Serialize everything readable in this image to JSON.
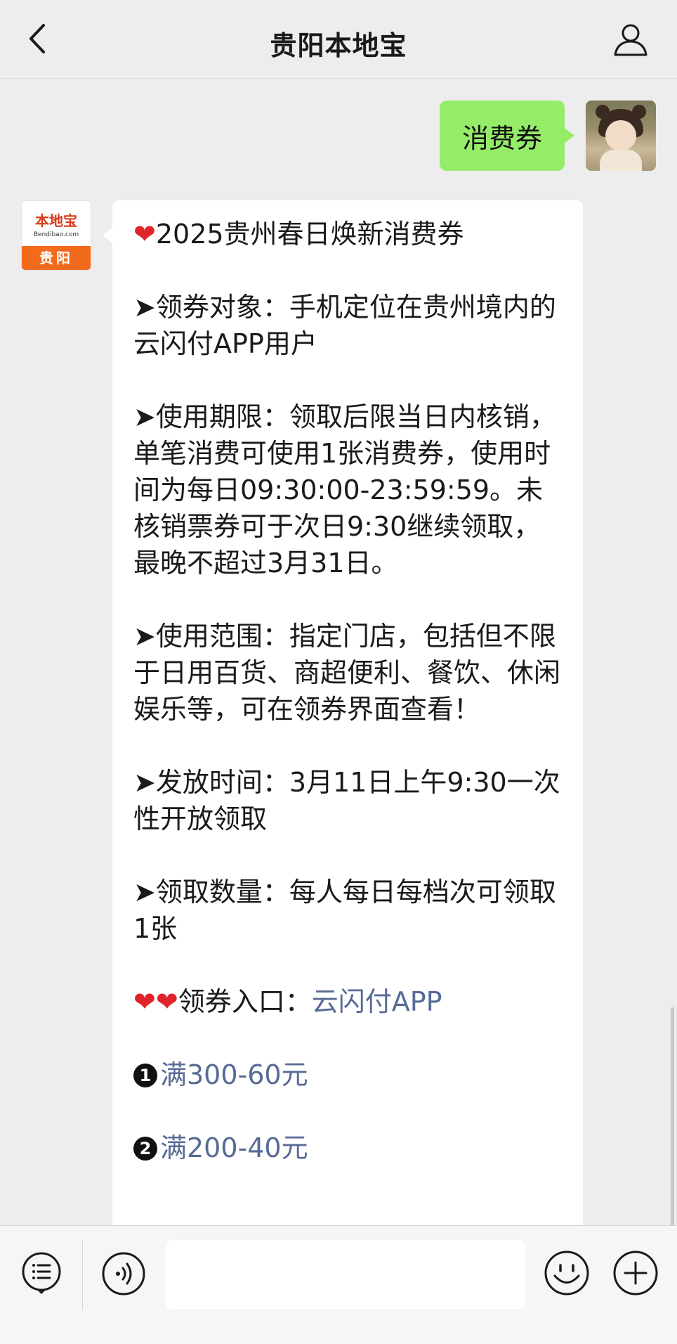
{
  "header": {
    "title": "贵阳本地宝"
  },
  "chat": {
    "my_message": "消费券",
    "bot_avatar": {
      "logo_text": "本地宝",
      "logo_url": "Bendibao.com",
      "city": "贵阳"
    },
    "bot_message": {
      "title": "2025贵州春日焕新消费券",
      "p1": "➤领券对象：手机定位在贵州境内的云闪付APP用户",
      "p2": "➤使用期限：领取后限当日内核销，单笔消费可使用1张消费券，使用时间为每日09:30:00-23:59:59。未核销票券可于次日9:30继续领取，最晚不超过3月31日。",
      "p3": "➤使用范围：指定门店，包括但不限于日用百货、商超便利、餐饮、休闲娱乐等，可在领券界面查看！",
      "p4": "➤发放时间：3月11日上午9:30一次性开放领取",
      "p5": "➤领取数量：每人每日每档次可领取1张",
      "entry_label": "领券入口：",
      "entry_link": "云闪付APP",
      "item1_num": "1",
      "item1_link": "满300-60元",
      "item2_num": "2",
      "item2_link": "满200-40元"
    }
  },
  "icons": {
    "back": "chevron-left-icon",
    "profile": "person-icon",
    "menu": "list-icon",
    "voice": "voice-icon",
    "emoji": "smiley-icon",
    "plus": "plus-icon"
  },
  "colors": {
    "my_bubble": "#95ec69",
    "link": "#576b95",
    "heart": "#e0242b",
    "logo_orange": "#f26b1d"
  }
}
